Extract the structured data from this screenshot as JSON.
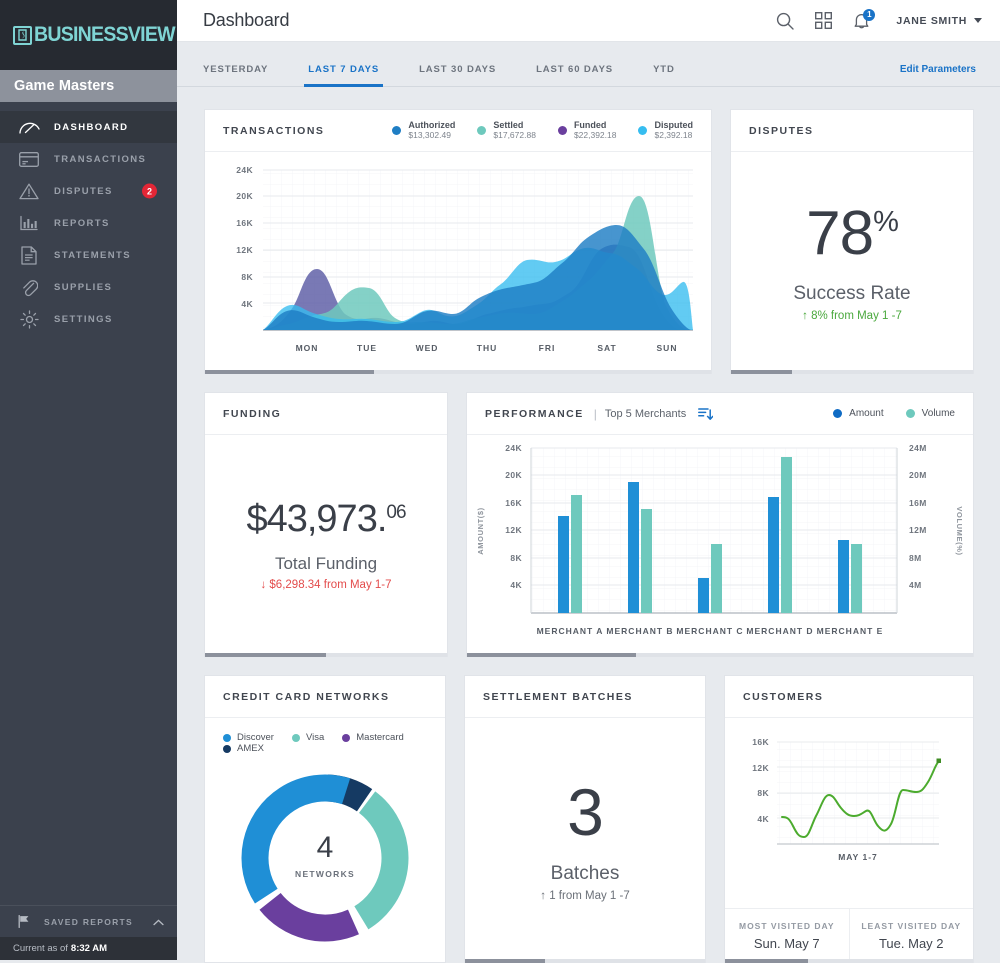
{
  "brand": {
    "logo_text": "BUSINESSVIEW",
    "logo_color": "#7fd4d4",
    "org_name": "Game Masters"
  },
  "sidebar": {
    "items": [
      {
        "label": "DASHBOARD",
        "icon": "gauge-icon",
        "active": true,
        "badge": ""
      },
      {
        "label": "TRANSACTIONS",
        "icon": "credit-card-icon",
        "active": false,
        "badge": ""
      },
      {
        "label": "DISPUTES",
        "icon": "warning-triangle-icon",
        "active": false,
        "badge": "2"
      },
      {
        "label": "REPORTS",
        "icon": "bar-chart-icon",
        "active": false,
        "badge": ""
      },
      {
        "label": "STATEMENTS",
        "icon": "document-icon",
        "active": false,
        "badge": ""
      },
      {
        "label": "SUPPLIES",
        "icon": "paperclip-icon",
        "active": false,
        "badge": ""
      },
      {
        "label": "SETTINGS",
        "icon": "gear-icon",
        "active": false,
        "badge": ""
      }
    ],
    "saved_reports_label": "SAVED REPORTS",
    "status_prefix": "Current as of",
    "status_time": "8:32 AM"
  },
  "header": {
    "title": "Dashboard",
    "user": "JANE SMITH",
    "notification_count": "1",
    "icons": [
      "search-icon",
      "apps-grid-icon",
      "bell-icon"
    ]
  },
  "tabs": {
    "items": [
      {
        "label": "YESTERDAY",
        "active": false
      },
      {
        "label": "LAST 7 DAYS",
        "active": true
      },
      {
        "label": "LAST 30 DAYS",
        "active": false
      },
      {
        "label": "LAST 60 DAYS",
        "active": false
      },
      {
        "label": "YTD",
        "active": false
      }
    ],
    "edit_parameters": "Edit Parameters",
    "accent": "#1a73c7"
  },
  "cards": {
    "transactions": {
      "title": "TRANSACTIONS",
      "carousel_total": 3,
      "carousel_active": 0
    },
    "disputes": {
      "title": "DISPUTES",
      "value": "78",
      "suffix": "%",
      "label": "Success Rate",
      "delta": "↑ 8% from May 1 -7",
      "delta_dir": "up",
      "carousel_total": 4,
      "carousel_active": 0
    },
    "funding": {
      "title": "FUNDING",
      "value": "$43,973.",
      "cents": "06",
      "label": "Total Funding",
      "delta": "↓ $6,298.34 from May 1-7",
      "delta_dir": "down",
      "carousel_total": 2,
      "carousel_active": 0
    },
    "performance": {
      "title": "PERFORMANCE",
      "subtitle": "Top 5 Merchants",
      "sort_icon": "sort-descending-icon",
      "carousel_total": 3,
      "carousel_active": 0
    },
    "networks": {
      "title": "CREDIT CARD NETWORKS",
      "center_value": "4",
      "center_label": "NETWORKS"
    },
    "batches": {
      "title": "SETTLEMENT BATCHES",
      "value": "3",
      "label": "Batches",
      "delta": "↑ 1 from May 1 -7",
      "delta_dir": "neutral",
      "carousel_total": 3,
      "carousel_active": 0
    },
    "customers": {
      "title": "CUSTOMERS",
      "range_label": "MAY 1-7",
      "most_visited_key": "MOST VISITED DAY",
      "most_visited_val": "Sun. May 7",
      "least_visited_key": "LEAST VISITED DAY",
      "least_visited_val": "Tue. May 2",
      "carousel_total": 3,
      "carousel_active": 0
    }
  },
  "chart_data": [
    {
      "id": "transactions",
      "type": "area",
      "title": "TRANSACTIONS",
      "xlabel": "",
      "ylabel": "",
      "categories": [
        "MON",
        "TUE",
        "WED",
        "THU",
        "FRI",
        "SAT",
        "SUN"
      ],
      "ylim": [
        0,
        24000
      ],
      "yticks": [
        4000,
        8000,
        12000,
        16000,
        20000,
        24000
      ],
      "ytick_labels": [
        "4K",
        "8K",
        "12K",
        "16K",
        "20K",
        "24K"
      ],
      "grid": true,
      "legend_position": "top-right",
      "series": [
        {
          "name": "Authorized",
          "total": "$13,302.49",
          "color": "#1f7ec4",
          "values": [
            1200,
            3400,
            1600,
            1200,
            900,
            3900,
            4100,
            8200,
            12600,
            15800,
            11500,
            2800,
            300
          ]
        },
        {
          "name": "Settled",
          "total": "$17,672.88",
          "color": "#6ec9bd",
          "values": [
            500,
            1400,
            1900,
            6200,
            2100,
            2600,
            1800,
            2900,
            3400,
            3000,
            11200,
            18700,
            400
          ]
        },
        {
          "name": "Funded",
          "total": "$22,392.18",
          "color": "#5b5ba5",
          "values": [
            700,
            2800,
            9200,
            3200,
            2400,
            2200,
            1100,
            2400,
            3500,
            3200,
            8300,
            12600,
            200
          ]
        },
        {
          "name": "Disputed",
          "total": "$2,392.18",
          "color": "#36bdf0",
          "values": [
            1400,
            3700,
            2100,
            1300,
            1100,
            3400,
            1500,
            4700,
            8200,
            9600,
            7800,
            5300,
            6500
          ]
        }
      ]
    },
    {
      "id": "performance",
      "type": "bar",
      "title": "PERFORMANCE",
      "subtitle": "Top 5 Merchants",
      "categories": [
        "MERCHANT A",
        "MERCHANT B",
        "MERCHANT C",
        "MERCHANT D",
        "MERCHANT E"
      ],
      "ylabel": "AMOUNT($)",
      "y2label": "VOLUME(%)",
      "ylim": [
        0,
        24000
      ],
      "yticks": [
        4000,
        8000,
        12000,
        16000,
        20000,
        24000
      ],
      "ytick_labels": [
        "4K",
        "8K",
        "12K",
        "16K",
        "20K",
        "24K"
      ],
      "y2lim": [
        0,
        24000000
      ],
      "y2tick_labels": [
        "4M",
        "8M",
        "12M",
        "16M",
        "20M",
        "24M"
      ],
      "grid": true,
      "legend_position": "top-right",
      "series": [
        {
          "name": "Amount",
          "color": "#1f8fd6",
          "values": [
            14100,
            19100,
            5100,
            16800,
            10700
          ]
        },
        {
          "name": "Volume",
          "color": "#6ec9bd",
          "values": [
            17100000,
            15100000,
            10100000,
            22700000,
            10100000
          ]
        }
      ]
    },
    {
      "id": "networks",
      "type": "pie",
      "title": "CREDIT CARD NETWORKS",
      "center_value": "4",
      "center_label": "NETWORKS",
      "labels": [
        "Discover",
        "Visa",
        "Mastercard",
        "AMEX"
      ],
      "values": [
        39,
        31,
        21,
        9
      ],
      "colors": [
        "#1f8fd6",
        "#6ec9bd",
        "#6a3f9e",
        "#153a63"
      ],
      "legend_position": "top-left"
    },
    {
      "id": "customers",
      "type": "line",
      "title": "CUSTOMERS",
      "xlabel": "MAY 1-7",
      "ylim": [
        0,
        16000
      ],
      "yticks": [
        4000,
        8000,
        12000,
        16000
      ],
      "ytick_labels": [
        "4K",
        "8K",
        "12K",
        "16K"
      ],
      "grid": true,
      "color": "#4cab2e",
      "series": [
        {
          "name": "Customers",
          "values": [
            4300,
            4200,
            2000,
            2900,
            7400,
            7800,
            6500,
            5200,
            5100,
            6300,
            3700,
            4000,
            8800,
            9000,
            8500,
            8400,
            9600,
            12500,
            13900
          ]
        }
      ]
    }
  ]
}
